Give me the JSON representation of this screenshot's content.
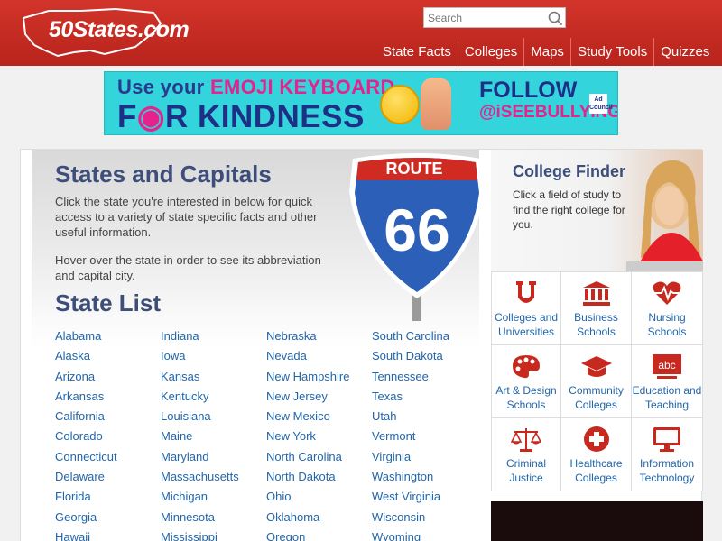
{
  "header": {
    "logo_text": "50States.com",
    "search": {
      "placeholder": "Search"
    },
    "nav": [
      "State Facts",
      "Colleges",
      "Maps",
      "Study Tools",
      "Quizzes"
    ]
  },
  "ad": {
    "line1_a": "Use your ",
    "line1_b": "EMOJI KEYBOARD",
    "line2_a": "F",
    "line2_b": "R KINDNESS",
    "follow": "FOLLOW",
    "handle": "@iSEEBULLYING",
    "council": "Ad Council"
  },
  "main": {
    "title": "States and Capitals",
    "intro1": "Click the state you're interested in below for quick access to a variety of state specific facts and other useful information.",
    "intro2": "Hover over the state in order to see its abbreviation and capital city.",
    "list_title": "State List",
    "route_label": "ROUTE",
    "route_number": "66",
    "states": [
      [
        "Alabama",
        "Indiana",
        "Nebraska",
        "South Carolina"
      ],
      [
        "Alaska",
        "Iowa",
        "Nevada",
        "South Dakota"
      ],
      [
        "Arizona",
        "Kansas",
        "New Hampshire",
        "Tennessee"
      ],
      [
        "Arkansas",
        "Kentucky",
        "New Jersey",
        "Texas"
      ],
      [
        "California",
        "Louisiana",
        "New Mexico",
        "Utah"
      ],
      [
        "Colorado",
        "Maine",
        "New York",
        "Vermont"
      ],
      [
        "Connecticut",
        "Maryland",
        "North Carolina",
        "Virginia"
      ],
      [
        "Delaware",
        "Massachusetts",
        "North Dakota",
        "Washington"
      ],
      [
        "Florida",
        "Michigan",
        "Ohio",
        "West Virginia"
      ],
      [
        "Georgia",
        "Minnesota",
        "Oklahoma",
        "Wisconsin"
      ],
      [
        "Hawaii",
        "Mississippi",
        "Oregon",
        "Wyoming"
      ]
    ]
  },
  "college_finder": {
    "title": "College Finder",
    "description": "Click a field of study to find the right college for you.",
    "fields": [
      {
        "label": "Colleges and Universities",
        "icon": "university-icon"
      },
      {
        "label": "Business Schools",
        "icon": "bank-icon"
      },
      {
        "label": "Nursing Schools",
        "icon": "heartbeat-icon"
      },
      {
        "label": "Art & Design Schools",
        "icon": "palette-icon"
      },
      {
        "label": "Community Colleges",
        "icon": "graduation-cap-icon"
      },
      {
        "label": "Education and Teaching",
        "icon": "abc-icon"
      },
      {
        "label": "Criminal Justice",
        "icon": "scales-icon"
      },
      {
        "label": "Healthcare Colleges",
        "icon": "medical-cross-icon"
      },
      {
        "label": "Information Technology",
        "icon": "monitor-icon"
      }
    ]
  },
  "colors": {
    "brand_red": "#c8291f",
    "link_blue": "#2266aa",
    "heading_navy": "#3d4e7a",
    "icon_red": "#c8291f"
  }
}
